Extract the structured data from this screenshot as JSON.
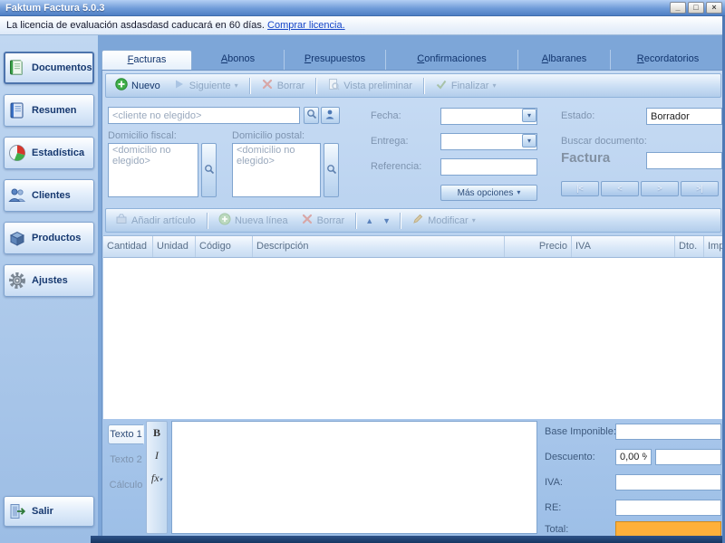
{
  "window": {
    "title": "Faktum Factura 5.0.3",
    "controls": {
      "minimize": "_",
      "maximize": "□",
      "close": "×"
    }
  },
  "license": {
    "text": "La licencia de evaluación asdasdasd caducará en 60 días.",
    "link": "Comprar licencia."
  },
  "sidebar": {
    "items": [
      {
        "label": "Documentos"
      },
      {
        "label": "Resumen"
      },
      {
        "label": "Estadística"
      },
      {
        "label": "Clientes"
      },
      {
        "label": "Productos"
      },
      {
        "label": "Ajustes"
      }
    ],
    "exit": {
      "label": "Salir"
    }
  },
  "tabs": [
    {
      "key": "F",
      "rest": "acturas"
    },
    {
      "key": "A",
      "rest": "bonos"
    },
    {
      "key": "P",
      "rest": "resupuestos"
    },
    {
      "key": "C",
      "rest": "onfirmaciones"
    },
    {
      "key": "A",
      "rest": "lbaranes"
    },
    {
      "key": "R",
      "rest": "ecordatorios"
    }
  ],
  "doc_toolbar": {
    "nuevo": "Nuevo",
    "siguiente": "Siguiente",
    "borrar": "Borrar",
    "vista_preliminar": "Vista preliminar",
    "finalizar": "Finalizar"
  },
  "header_form": {
    "cliente_placeholder": "<cliente no elegido>",
    "domicilio_fiscal_label": "Domicilio fiscal:",
    "domicilio_postal_label": "Domicilio postal:",
    "domicilio_placeholder": "<domicilio no elegido>",
    "fecha_label": "Fecha:",
    "entrega_label": "Entrega:",
    "referencia_label": "Referencia:",
    "mas_opciones_label": "Más opciones",
    "estado_label": "Estado:",
    "estado_value": "Borrador",
    "buscar_documento_label": "Buscar documento:",
    "documento_tipo": "Factura",
    "nav": {
      "first": "|<",
      "prev": "<",
      "next": ">",
      "last": ">|"
    }
  },
  "lines_toolbar": {
    "anadir_articulo": "Añadir artículo",
    "nueva_linea": "Nueva línea",
    "borrar": "Borrar",
    "modificar": "Modificar"
  },
  "items_table": {
    "columns": [
      "Cantidad",
      "Unidad",
      "Código",
      "Descripción",
      "Precio",
      "IVA",
      "Dto.",
      "Importe"
    ]
  },
  "notes": {
    "tabs": [
      "Texto 1",
      "Texto 2",
      "Cálculo"
    ],
    "bold": "B",
    "italic": "I",
    "formula": "fx"
  },
  "totals": {
    "base_label": "Base Imponible:",
    "descuento_label": "Descuento:",
    "descuento_value": "0,00 %",
    "iva_label": "IVA:",
    "re_label": "RE:",
    "total_label": "Total:"
  },
  "glyphs": {
    "caret": "▾",
    "up": "▲",
    "down": "▼"
  },
  "colors": {
    "accent_orange": "#ffb03a",
    "titlebar_blue": "#6f9bd8"
  }
}
